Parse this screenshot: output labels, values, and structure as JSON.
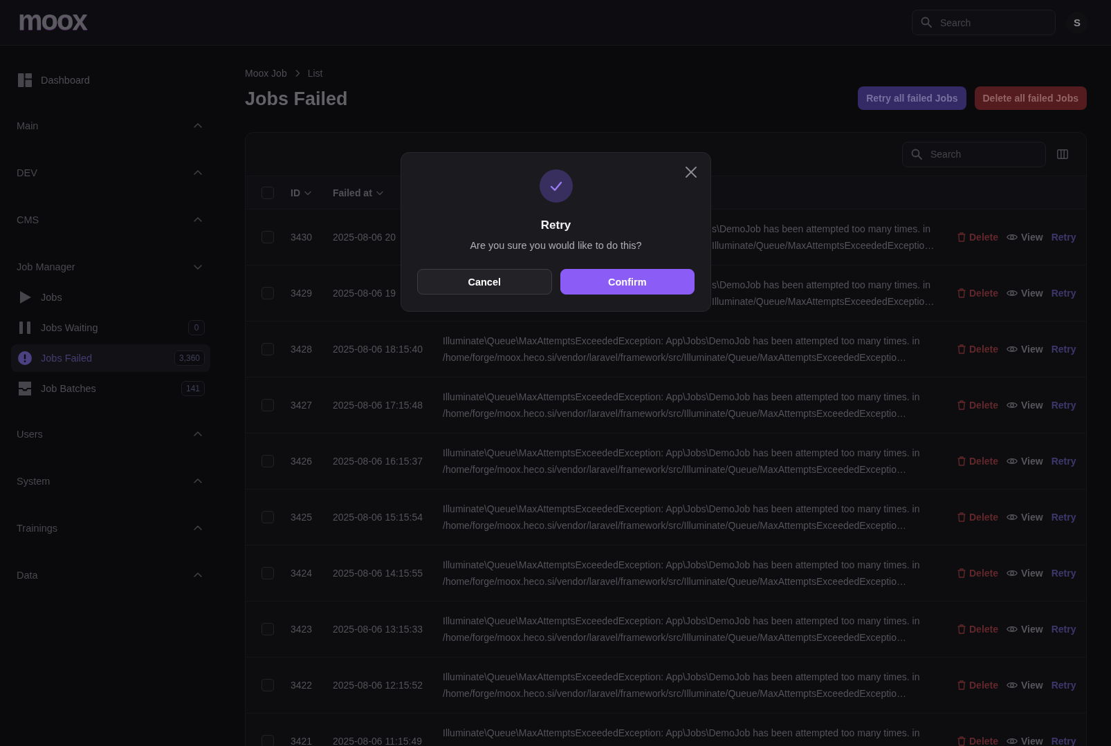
{
  "topbar": {
    "logo": "moox",
    "search": {
      "placeholder": "Search"
    },
    "avatar": "S"
  },
  "sidebar": {
    "dashboard": {
      "label": "Dashboard",
      "selected": false
    },
    "groups": [
      {
        "label": "Main",
        "expanded": false
      },
      {
        "label": "DEV",
        "expanded": false
      },
      {
        "label": "CMS",
        "expanded": false
      },
      {
        "label": "Job Manager",
        "expanded": true,
        "items": [
          {
            "label": "Jobs",
            "selected": false
          },
          {
            "label": "Jobs Waiting",
            "badge": "0",
            "selected": false
          },
          {
            "label": "Jobs Failed",
            "badge": "3,360",
            "selected": true
          },
          {
            "label": "Job Batches",
            "badge": "141",
            "selected": false
          }
        ]
      },
      {
        "label": "Users",
        "expanded": false
      },
      {
        "label": "System",
        "expanded": false
      },
      {
        "label": "Trainings",
        "expanded": false
      },
      {
        "label": "Data",
        "expanded": false
      }
    ]
  },
  "breadcrumbs": [
    "Moox Job",
    "List"
  ],
  "page_title": "Jobs Failed",
  "header_actions": [
    {
      "label": "Retry all failed Jobs",
      "kind": "retry"
    },
    {
      "label": "Delete all failed Jobs",
      "kind": "delete"
    }
  ],
  "table": {
    "search": {
      "placeholder": "Search"
    },
    "select_all": {
      "checked": false
    },
    "columns": [
      {
        "label": "ID"
      },
      {
        "label": "Failed at"
      }
    ],
    "rows": [
      {
        "id": "3430",
        "failed_at": "2025-08-06 20",
        "message": "s\\DemoJob has been attempted too many times. in Illuminate/Queue/MaxAttemptsExceededExceptio…",
        "kind": "covered",
        "checked": false,
        "actions": [
          {
            "label": "Delete",
            "kind": "delete"
          },
          {
            "label": "View",
            "kind": "view"
          },
          {
            "label": "Retry",
            "kind": "retry"
          }
        ]
      },
      {
        "id": "3429",
        "failed_at": "2025-08-06 19",
        "message": "s\\DemoJob has been attempted too many times. in Illuminate/Queue/MaxAttemptsExceededExceptio…",
        "kind": "covered",
        "checked": false,
        "actions": [
          {
            "label": "Delete",
            "kind": "delete"
          },
          {
            "label": "View",
            "kind": "view"
          },
          {
            "label": "Retry",
            "kind": "retry"
          }
        ]
      },
      {
        "id": "3428",
        "failed_at": "2025-08-06 18:15:40",
        "message": "Illuminate\\Queue\\MaxAttemptsExceededException: App\\Jobs\\DemoJob has been attempted too many times. in /home/forge/moox.heco.si/vendor/laravel/framework/src/Illuminate/Queue/MaxAttemptsExceededExceptio…",
        "kind": "full",
        "checked": false,
        "actions": [
          {
            "label": "Delete",
            "kind": "delete"
          },
          {
            "label": "View",
            "kind": "view"
          },
          {
            "label": "Retry",
            "kind": "retry"
          }
        ]
      },
      {
        "id": "3427",
        "failed_at": "2025-08-06 17:15:48",
        "message": "Illuminate\\Queue\\MaxAttemptsExceededException: App\\Jobs\\DemoJob has been attempted too many times. in /home/forge/moox.heco.si/vendor/laravel/framework/src/Illuminate/Queue/MaxAttemptsExceededExceptio…",
        "kind": "full",
        "checked": false,
        "actions": [
          {
            "label": "Delete",
            "kind": "delete"
          },
          {
            "label": "View",
            "kind": "view"
          },
          {
            "label": "Retry",
            "kind": "retry"
          }
        ]
      },
      {
        "id": "3426",
        "failed_at": "2025-08-06 16:15:37",
        "message": "Illuminate\\Queue\\MaxAttemptsExceededException: App\\Jobs\\DemoJob has been attempted too many times. in /home/forge/moox.heco.si/vendor/laravel/framework/src/Illuminate/Queue/MaxAttemptsExceededExceptio…",
        "kind": "full",
        "checked": false,
        "actions": [
          {
            "label": "Delete",
            "kind": "delete"
          },
          {
            "label": "View",
            "kind": "view"
          },
          {
            "label": "Retry",
            "kind": "retry"
          }
        ]
      },
      {
        "id": "3425",
        "failed_at": "2025-08-06 15:15:54",
        "message": "Illuminate\\Queue\\MaxAttemptsExceededException: App\\Jobs\\DemoJob has been attempted too many times. in /home/forge/moox.heco.si/vendor/laravel/framework/src/Illuminate/Queue/MaxAttemptsExceededExceptio…",
        "kind": "full",
        "checked": false,
        "actions": [
          {
            "label": "Delete",
            "kind": "delete"
          },
          {
            "label": "View",
            "kind": "view"
          },
          {
            "label": "Retry",
            "kind": "retry"
          }
        ]
      },
      {
        "id": "3424",
        "failed_at": "2025-08-06 14:15:55",
        "message": "Illuminate\\Queue\\MaxAttemptsExceededException: App\\Jobs\\DemoJob has been attempted too many times. in /home/forge/moox.heco.si/vendor/laravel/framework/src/Illuminate/Queue/MaxAttemptsExceededExceptio…",
        "kind": "full",
        "checked": false,
        "actions": [
          {
            "label": "Delete",
            "kind": "delete"
          },
          {
            "label": "View",
            "kind": "view"
          },
          {
            "label": "Retry",
            "kind": "retry"
          }
        ]
      },
      {
        "id": "3423",
        "failed_at": "2025-08-06 13:15:33",
        "message": "Illuminate\\Queue\\MaxAttemptsExceededException: App\\Jobs\\DemoJob has been attempted too many times. in /home/forge/moox.heco.si/vendor/laravel/framework/src/Illuminate/Queue/MaxAttemptsExceededExceptio…",
        "kind": "full",
        "checked": false,
        "actions": [
          {
            "label": "Delete",
            "kind": "delete"
          },
          {
            "label": "View",
            "kind": "view"
          },
          {
            "label": "Retry",
            "kind": "retry"
          }
        ]
      },
      {
        "id": "3422",
        "failed_at": "2025-08-06 12:15:52",
        "message": "Illuminate\\Queue\\MaxAttemptsExceededException: App\\Jobs\\DemoJob has been attempted too many times. in /home/forge/moox.heco.si/vendor/laravel/framework/src/Illuminate/Queue/MaxAttemptsExceededExceptio…",
        "kind": "full",
        "checked": false,
        "actions": [
          {
            "label": "Delete",
            "kind": "delete"
          },
          {
            "label": "View",
            "kind": "view"
          },
          {
            "label": "Retry",
            "kind": "retry"
          }
        ]
      },
      {
        "id": "3421",
        "failed_at": "2025-08-06 11:15:49",
        "message": "Illuminate\\Queue\\MaxAttemptsExceededException: App\\Jobs\\DemoJob has been attempted too many times. in",
        "kind": "full",
        "checked": false,
        "actions": [
          {
            "label": "Delete",
            "kind": "delete"
          },
          {
            "label": "View",
            "kind": "view"
          },
          {
            "label": "Retry",
            "kind": "retry"
          }
        ]
      }
    ]
  },
  "dialog": {
    "title": "Retry",
    "message": "Are you sure you would like to do this?",
    "actions": [
      {
        "label": "Cancel",
        "kind": "cancel"
      },
      {
        "label": "Confirm",
        "kind": "confirm"
      }
    ]
  }
}
